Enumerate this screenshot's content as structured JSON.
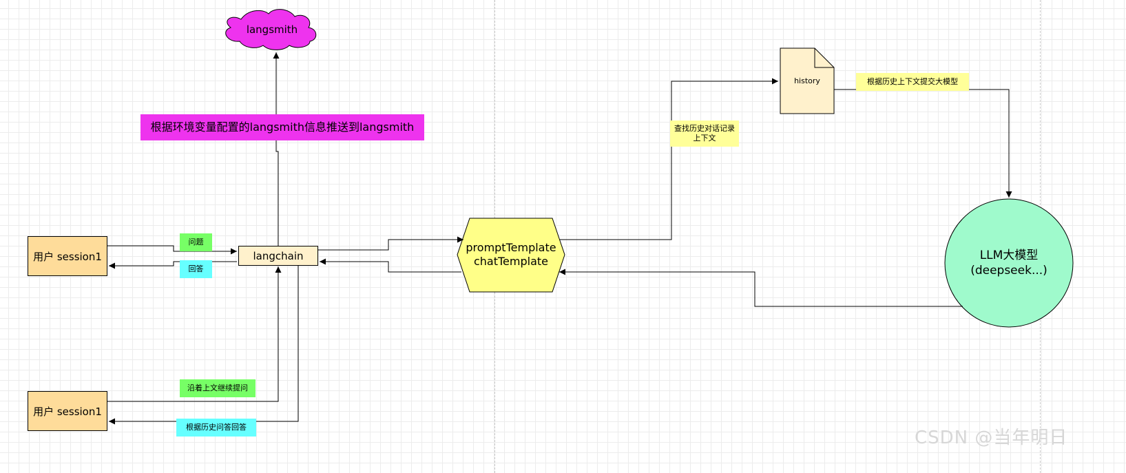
{
  "nodes": {
    "langsmith": "langsmith",
    "langchain": "langchain",
    "user_top": "用户 session1",
    "user_bottom": "用户 session1",
    "prompt_line1": "promptTemplate",
    "prompt_line2": "chatTemplate",
    "history": "history",
    "llm_line1": "LLM大模型",
    "llm_line2": "(deepseek...)"
  },
  "labels": {
    "push_langsmith": "根据环境变量配置的langsmith信息推送到langsmith",
    "question": "问题",
    "answer": "回答",
    "follow_up": "沿着上文继续提问",
    "history_answer": "根据历史问答回答",
    "lookup_history_line1": "查找历史对话记录",
    "lookup_history_line2": "上下文",
    "submit_llm": "根据历史上下文提交大模型"
  },
  "watermark": "CSDN @当年明日",
  "colors": {
    "langsmith_fill": "#ee33ee",
    "user_fill": "#fedc9a",
    "langchain_fill": "#fff1cc",
    "prompt_fill": "#ffff88",
    "history_fill": "#fff1cc",
    "llm_fill": "#9ffacc",
    "label_green": "#77ff66",
    "label_cyan": "#66ffff",
    "label_yellow": "#ffff99",
    "label_magenta": "#ee33ee"
  }
}
